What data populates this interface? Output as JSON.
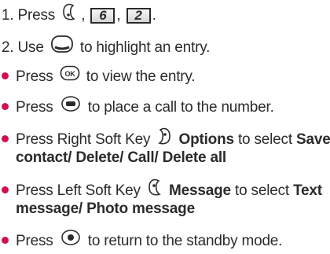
{
  "steps": [
    {
      "prefix": "1. Press",
      "keys": [
        "6",
        "2"
      ],
      "sep": ",",
      "end": "."
    },
    {
      "prefix": "2.  Use",
      "text": "to highlight an entry."
    }
  ],
  "bullets": [
    {
      "pre": "Press",
      "post": "to view the entry."
    },
    {
      "pre": "Press",
      "post": "to place a call to the number."
    },
    {
      "pre": "Press Right Soft Key",
      "bold1": "Options",
      "mid": "to select",
      "bold2": "Save",
      "line2_bold_a": "contact/",
      "line2_bold_b": "Delete/",
      "line2_bold_c": "Call/",
      "line2_bold_d": "Delete all"
    },
    {
      "pre": "Press Left Soft Key",
      "bold1": "Message",
      "mid": "to select",
      "bold2": "Text",
      "line2_bold_a": "message/",
      "line2_bold_b": "Photo message"
    },
    {
      "pre": "Press",
      "post": "to return to the standby mode."
    }
  ],
  "icons": {
    "left_soft": "left-soft-key-icon",
    "nav": "navigation-key-icon",
    "ok": "ok-key-icon",
    "send": "send-key-icon",
    "right_soft": "right-soft-key-icon",
    "end": "end-key-icon"
  },
  "colors": {
    "bullet": "#d0104c",
    "text": "#2b2b2b"
  }
}
